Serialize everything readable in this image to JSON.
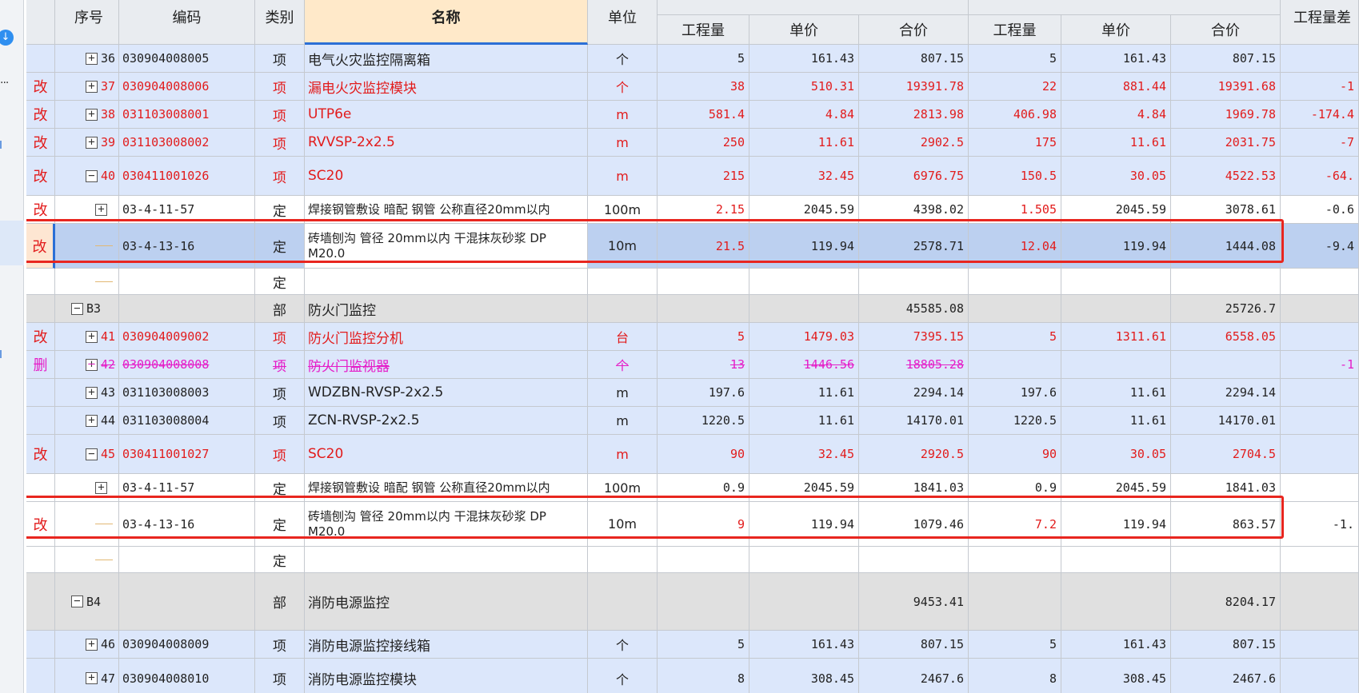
{
  "left_panel": {
    "download_icon": "download-icon",
    "more_label": "···"
  },
  "headers": {
    "seq": "序号",
    "code": "编码",
    "type": "类别",
    "name": "名称",
    "unit": "单位",
    "group_a": "",
    "group_b": "",
    "qty_diff": "工程量差",
    "qty": "工程量",
    "price": "单价",
    "total": "合价"
  },
  "rows": [
    {
      "status": "item",
      "flag": "",
      "toggle": "+",
      "seq": "36",
      "code": "030904008005",
      "type": "项",
      "name": "电气火灾监控隔离箱",
      "unit": "个",
      "a_qty": "5",
      "a_price": "161.43",
      "a_total": "807.15",
      "b_qty": "5",
      "b_price": "161.43",
      "b_total": "807.15",
      "diff": "",
      "color": ""
    },
    {
      "status": "item",
      "flag": "改",
      "toggle": "+",
      "seq": "37",
      "code": "030904008006",
      "type": "项",
      "name": "漏电火灾监控模块",
      "unit": "个",
      "a_qty": "38",
      "a_price": "510.31",
      "a_total": "19391.78",
      "b_qty": "22",
      "b_price": "881.44",
      "b_total": "19391.68",
      "diff": "-1",
      "color": "red"
    },
    {
      "status": "item",
      "flag": "改",
      "toggle": "+",
      "seq": "38",
      "code": "031103008001",
      "type": "项",
      "name": "UTP6e",
      "unit": "m",
      "a_qty": "581.4",
      "a_price": "4.84",
      "a_total": "2813.98",
      "b_qty": "406.98",
      "b_price": "4.84",
      "b_total": "1969.78",
      "diff": "-174.4",
      "color": "red"
    },
    {
      "status": "item",
      "flag": "改",
      "toggle": "+",
      "seq": "39",
      "code": "031103008002",
      "type": "项",
      "name": "RVVSP-2x2.5",
      "unit": "m",
      "a_qty": "250",
      "a_price": "11.61",
      "a_total": "2902.5",
      "b_qty": "175",
      "b_price": "11.61",
      "b_total": "2031.75",
      "diff": "-7",
      "color": "red"
    },
    {
      "status": "item",
      "flag": "改",
      "toggle": "−",
      "seq": "40",
      "code": "030411001026",
      "type": "项",
      "name": "SC20",
      "unit": "m",
      "a_qty": "215",
      "a_price": "32.45",
      "a_total": "6976.75",
      "b_qty": "150.5",
      "b_price": "30.05",
      "b_total": "4522.53",
      "diff": "-64.",
      "color": "red"
    },
    {
      "status": "quota",
      "flag": "改",
      "toggle": "+",
      "seq": "",
      "code": "03-4-11-57",
      "type": "定",
      "name": "焊接钢管敷设 暗配 钢管 公称直径20mm以内",
      "unit": "100m",
      "a_qty": "2.15",
      "a_price": "2045.59",
      "a_total": "4398.02",
      "b_qty": "1.505",
      "b_price": "2045.59",
      "b_total": "3078.61",
      "diff": "-0.6",
      "color": "partial"
    },
    {
      "status": "sel",
      "flag": "改",
      "toggle": "",
      "seq": "",
      "code": "03-4-13-16",
      "type": "定",
      "name": "砖墙刨沟 管径 20mm以内 干混抹灰砂浆 DP M20.0",
      "unit": "10m",
      "a_qty": "21.5",
      "a_price": "119.94",
      "a_total": "2578.71",
      "b_qty": "12.04",
      "b_price": "119.94",
      "b_total": "1444.08",
      "diff": "-9.4",
      "color": "partial"
    },
    {
      "status": "quota",
      "flag": "",
      "toggle": "",
      "seq": "",
      "code": "",
      "type": "定",
      "name": "",
      "unit": "",
      "a_qty": "",
      "a_price": "",
      "a_total": "",
      "b_qty": "",
      "b_price": "",
      "b_total": "",
      "diff": "",
      "color": ""
    },
    {
      "status": "section",
      "flag": "",
      "toggle": "−",
      "seq": "B3",
      "code": "",
      "type": "部",
      "name": "防火门监控",
      "unit": "",
      "a_qty": "",
      "a_price": "",
      "a_total": "45585.08",
      "b_qty": "",
      "b_price": "",
      "b_total": "25726.7",
      "diff": "",
      "color": ""
    },
    {
      "status": "item",
      "flag": "改",
      "toggle": "+",
      "seq": "41",
      "code": "030904009002",
      "type": "项",
      "name": "防火门监控分机",
      "unit": "台",
      "a_qty": "5",
      "a_price": "1479.03",
      "a_total": "7395.15",
      "b_qty": "5",
      "b_price": "1311.61",
      "b_total": "6558.05",
      "diff": "",
      "color": "red"
    },
    {
      "status": "item",
      "flag": "删",
      "toggle": "+",
      "seq": "42",
      "code": "030904008008",
      "type": "项",
      "name": "防火门监视器",
      "unit": "个",
      "a_qty": "13",
      "a_price": "1446.56",
      "a_total": "18805.28",
      "b_qty": "",
      "b_price": "",
      "b_total": "",
      "diff": "-1",
      "color": "pink"
    },
    {
      "status": "item",
      "flag": "",
      "toggle": "+",
      "seq": "43",
      "code": "031103008003",
      "type": "项",
      "name": "WDZBN-RVSP-2x2.5",
      "unit": "m",
      "a_qty": "197.6",
      "a_price": "11.61",
      "a_total": "2294.14",
      "b_qty": "197.6",
      "b_price": "11.61",
      "b_total": "2294.14",
      "diff": "",
      "color": ""
    },
    {
      "status": "item",
      "flag": "",
      "toggle": "+",
      "seq": "44",
      "code": "031103008004",
      "type": "项",
      "name": "ZCN-RVSP-2x2.5",
      "unit": "m",
      "a_qty": "1220.5",
      "a_price": "11.61",
      "a_total": "14170.01",
      "b_qty": "1220.5",
      "b_price": "11.61",
      "b_total": "14170.01",
      "diff": "",
      "color": ""
    },
    {
      "status": "item",
      "flag": "改",
      "toggle": "−",
      "seq": "45",
      "code": "030411001027",
      "type": "项",
      "name": "SC20",
      "unit": "m",
      "a_qty": "90",
      "a_price": "32.45",
      "a_total": "2920.5",
      "b_qty": "90",
      "b_price": "30.05",
      "b_total": "2704.5",
      "diff": "",
      "color": "red"
    },
    {
      "status": "quota",
      "flag": "",
      "toggle": "+",
      "seq": "",
      "code": "03-4-11-57",
      "type": "定",
      "name": "焊接钢管敷设 暗配 钢管 公称直径20mm以内",
      "unit": "100m",
      "a_qty": "0.9",
      "a_price": "2045.59",
      "a_total": "1841.03",
      "b_qty": "0.9",
      "b_price": "2045.59",
      "b_total": "1841.03",
      "diff": "",
      "color": ""
    },
    {
      "status": "quota",
      "flag": "改",
      "toggle": "",
      "seq": "",
      "code": "03-4-13-16",
      "type": "定",
      "name": "砖墙刨沟 管径 20mm以内 干混抹灰砂浆 DP M20.0",
      "unit": "10m",
      "a_qty": "9",
      "a_price": "119.94",
      "a_total": "1079.46",
      "b_qty": "7.2",
      "b_price": "119.94",
      "b_total": "863.57",
      "diff": "-1.",
      "color": "partial"
    },
    {
      "status": "quota",
      "flag": "",
      "toggle": "",
      "seq": "",
      "code": "",
      "type": "定",
      "name": "",
      "unit": "",
      "a_qty": "",
      "a_price": "",
      "a_total": "",
      "b_qty": "",
      "b_price": "",
      "b_total": "",
      "diff": "",
      "color": ""
    },
    {
      "status": "section",
      "flag": "",
      "toggle": "−",
      "seq": "B4",
      "code": "",
      "type": "部",
      "name": "消防电源监控",
      "unit": "",
      "a_qty": "",
      "a_price": "",
      "a_total": "9453.41",
      "b_qty": "",
      "b_price": "",
      "b_total": "8204.17",
      "diff": "",
      "color": ""
    },
    {
      "status": "item",
      "flag": "",
      "toggle": "+",
      "seq": "46",
      "code": "030904008009",
      "type": "项",
      "name": "消防电源监控接线箱",
      "unit": "个",
      "a_qty": "5",
      "a_price": "161.43",
      "a_total": "807.15",
      "b_qty": "5",
      "b_price": "161.43",
      "b_total": "807.15",
      "diff": "",
      "color": ""
    },
    {
      "status": "item",
      "flag": "",
      "toggle": "+",
      "seq": "47",
      "code": "030904008010",
      "type": "项",
      "name": "消防电源监控模块",
      "unit": "个",
      "a_qty": "8",
      "a_price": "308.45",
      "a_total": "2467.6",
      "b_qty": "8",
      "b_price": "308.45",
      "b_total": "2467.6",
      "diff": "",
      "color": ""
    }
  ]
}
